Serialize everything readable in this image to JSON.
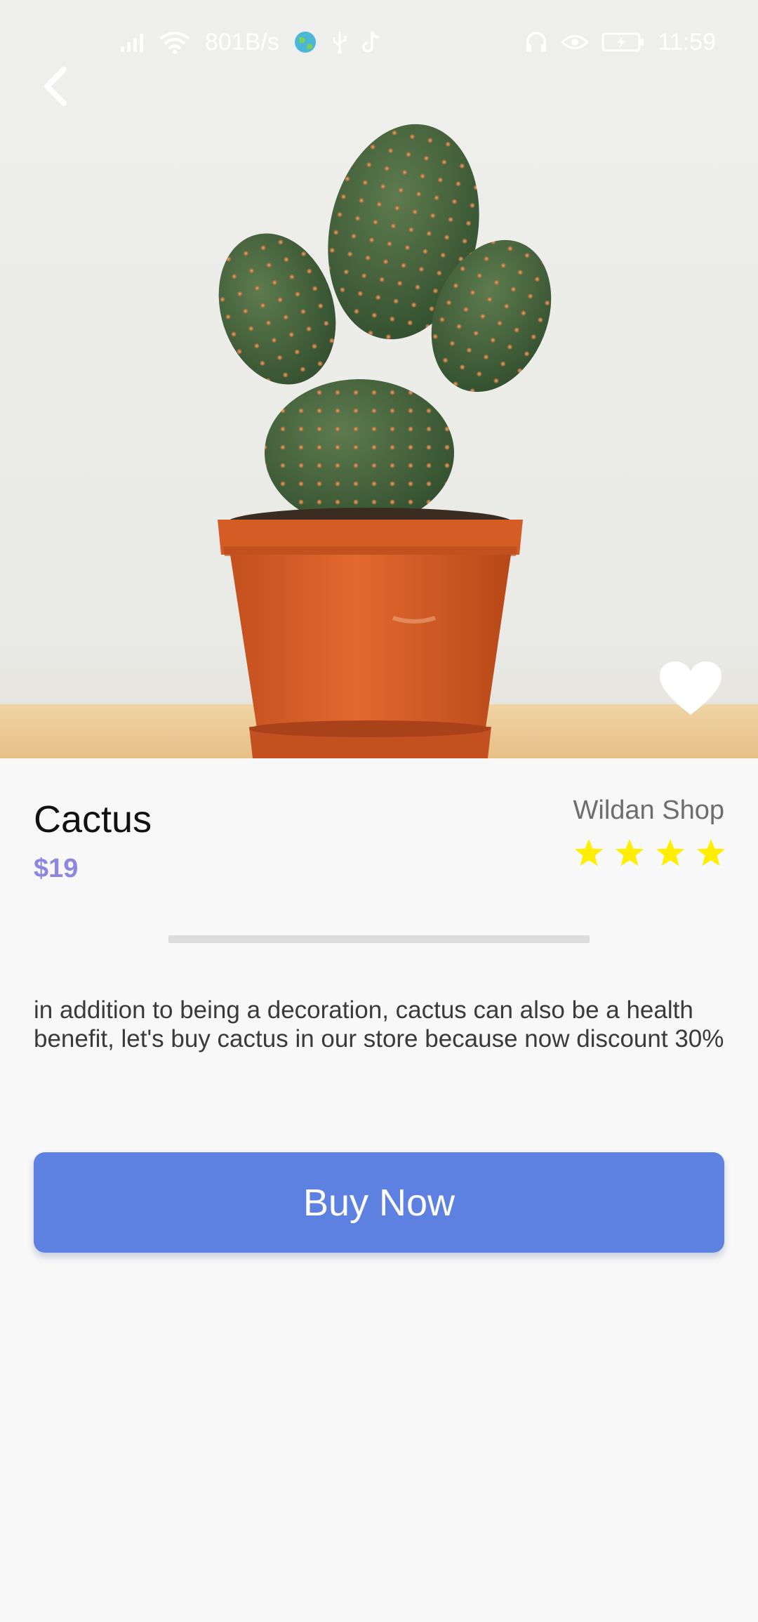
{
  "status_bar": {
    "network_speed": "801B/s",
    "time": "11:59"
  },
  "product": {
    "name": "Cactus",
    "price": "$19",
    "shop": "Wildan Shop",
    "rating": 4,
    "rating_max": 4,
    "description": "in addition to being a decoration, cactus can also be a health benefit, let's buy cactus in our store because now discount 30%"
  },
  "actions": {
    "buy_label": "Buy Now"
  },
  "colors": {
    "accent_button": "#5d81e0",
    "price": "#8f86e2",
    "star": "#ffee00"
  },
  "icons": {
    "back": "back-arrow-icon",
    "favorite": "heart-icon",
    "star": "star-icon"
  }
}
